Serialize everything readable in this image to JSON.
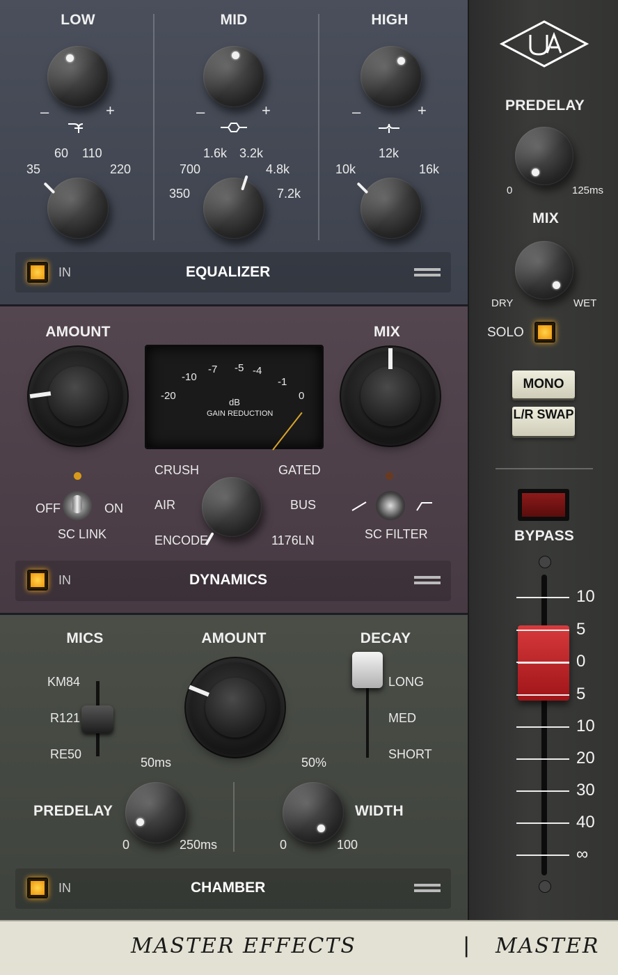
{
  "equalizer": {
    "low": {
      "title": "LOW",
      "minus": "–",
      "plus": "+",
      "freqs": [
        "35",
        "60",
        "110",
        "220"
      ]
    },
    "mid": {
      "title": "MID",
      "minus": "–",
      "plus": "+",
      "freqs": [
        "350",
        "700",
        "1.6k",
        "3.2k",
        "4.8k",
        "7.2k"
      ]
    },
    "high": {
      "title": "HIGH",
      "minus": "–",
      "plus": "+",
      "freqs": [
        "10k",
        "12k",
        "16k"
      ]
    },
    "in_label": "IN",
    "title": "EQUALIZER"
  },
  "dynamics": {
    "amount_label": "AMOUNT",
    "mix_label": "MIX",
    "meter": {
      "scale": [
        "-20",
        "-10",
        "-7",
        "-5",
        "-4",
        "-1",
        "0"
      ],
      "unit": "dB",
      "caption": "GAIN REDUCTION"
    },
    "sc_link": {
      "off": "OFF",
      "on": "ON",
      "label": "SC LINK"
    },
    "modes": {
      "crush": "CRUSH",
      "gated": "GATED",
      "air": "AIR",
      "bus": "BUS",
      "encode": "ENCODE",
      "ln1176": "1176LN"
    },
    "sc_filter_label": "SC FILTER",
    "in_label": "IN",
    "title": "DYNAMICS"
  },
  "chamber": {
    "mics_label": "MICS",
    "mics": [
      "KM84",
      "R121",
      "RE50"
    ],
    "amount_label": "AMOUNT",
    "decay_label": "DECAY",
    "decay_options": [
      "LONG",
      "MED",
      "SHORT"
    ],
    "predelay": {
      "label": "PREDELAY",
      "min": "0",
      "mid": "50ms",
      "max": "250ms"
    },
    "width": {
      "label": "WIDTH",
      "min": "0",
      "mid": "50%",
      "max": "100"
    },
    "in_label": "IN",
    "title": "CHAMBER"
  },
  "side": {
    "predelay": {
      "label": "PREDELAY",
      "min": "0",
      "max": "125ms"
    },
    "mix": {
      "label": "MIX",
      "min": "DRY",
      "max": "WET"
    },
    "solo_label": "SOLO",
    "mono_label": "MONO",
    "lr_swap_label": "L/R SWAP",
    "bypass_label": "BYPASS",
    "fader_scale": [
      "10",
      "5",
      "0",
      "5",
      "10",
      "20",
      "30",
      "40",
      "∞"
    ]
  },
  "footer": {
    "left": "MASTER EFFECTS",
    "sep": "|",
    "right": "MASTER"
  },
  "colors": {
    "eq_bg": "#444954",
    "dyn_bg": "#4d4049",
    "chamber_bg": "#454942",
    "led": "#f5a91c",
    "bypass": "#7a1414",
    "fader_cap": "#c4242a"
  }
}
